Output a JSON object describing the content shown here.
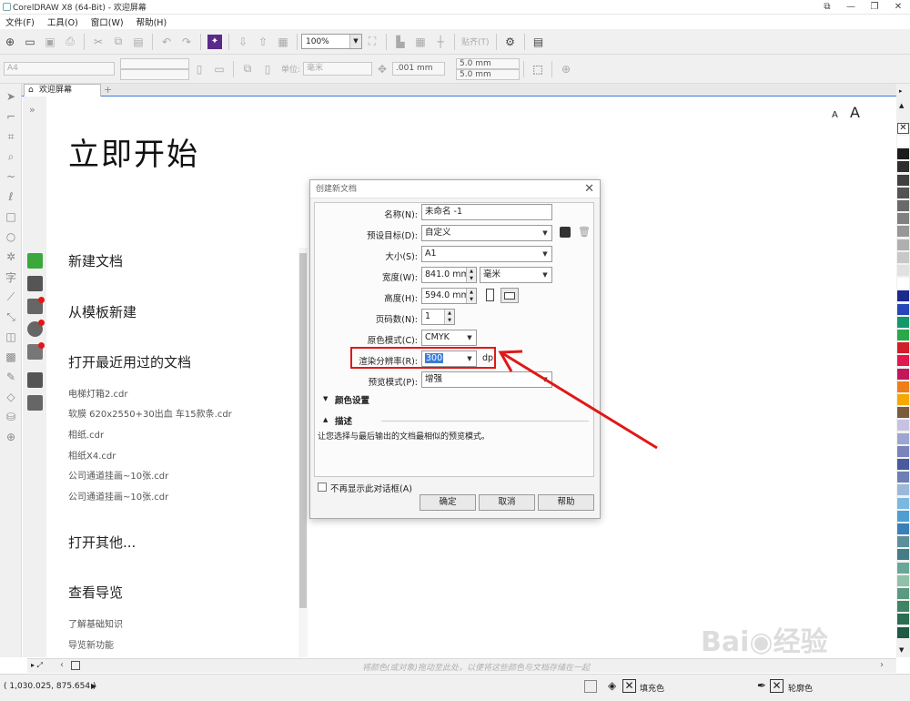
{
  "window": {
    "title": "CorelDRAW X8 (64-Bit) - 欢迎屏幕",
    "controls": [
      "⧉",
      "—",
      "❐",
      "✕"
    ]
  },
  "menu": [
    "文件(F)",
    "工具(O)",
    "窗口(W)",
    "帮助(H)"
  ],
  "toolbar": {
    "zoom": "100%",
    "snap_label": "贴齐(T)"
  },
  "property_bar": {
    "page_size": "A4",
    "units_label": "单位:",
    "units_value": "毫米",
    "nudge": ".001 mm",
    "dup_x": "5.0 mm",
    "dup_y": "5.0 mm"
  },
  "tab": {
    "label": "欢迎屏幕",
    "plus": "+"
  },
  "welcome": {
    "title": "立即开始",
    "new_doc": "新建文档",
    "from_template": "从模板新建",
    "open_recent": "打开最近用过的文档",
    "recent_files": [
      "电梯灯箱2.cdr",
      "软膜 620x2550+30出血 车15款条.cdr",
      "相纸.cdr",
      "相纸X4.cdr",
      "公司通道挂画~10张.cdr",
      "公司通道挂画~10张.cdr"
    ],
    "open_other": "打开其他...",
    "guide": "查看导览",
    "guide_items": [
      "了解基础知识",
      "导览新功能"
    ],
    "font_small": "A",
    "font_large": "A"
  },
  "dialog": {
    "title": "创建新文档",
    "close": "✕",
    "fields": [
      {
        "label": "名称(N):",
        "value": "未命名 -1"
      },
      {
        "label": "预设目标(D):",
        "value": "自定义"
      },
      {
        "label": "大小(S):",
        "value": "A1"
      },
      {
        "label": "宽度(W):",
        "value": "841.0 mm",
        "unit": "毫米"
      },
      {
        "label": "高度(H):",
        "value": "594.0 mm"
      },
      {
        "label": "页码数(N):",
        "value": "1"
      },
      {
        "label": "原色模式(C):",
        "value": "CMYK"
      },
      {
        "label": "渲染分辨率(R):",
        "value": "300",
        "unit": "dpi"
      },
      {
        "label": "预览模式(P):",
        "value": "增强"
      }
    ],
    "color_settings": "颜色设置",
    "description_header": "描述",
    "description": "让您选择与最后输出的文档最相似的预览模式。",
    "dont_show": "不再显示此对话框(A)",
    "ok": "确定",
    "cancel": "取消",
    "help": "帮助"
  },
  "hscroll_hint": "将颜色(或对象)拖动至此处，以便将这些颜色与文档存储在一起",
  "status": {
    "coords": "( 1,030.025, 875.654 )",
    "fill_label": "填充色",
    "outline_label": "轮廓色"
  },
  "annotation_color": "#e01818",
  "palette_colors": [
    "#ffffff",
    "#1c1c1c",
    "#2e2e2e",
    "#404040",
    "#545454",
    "#6a6a6a",
    "#808080",
    "#979797",
    "#afafaf",
    "#c8c8c8",
    "#e1e1e1",
    "#ffffff",
    "#1b2a8c",
    "#2747b8",
    "#11986b",
    "#2aa84a",
    "#d21e2a",
    "#e0184d",
    "#c2185b",
    "#ef7d18",
    "#f6a800",
    "#7a5c3a",
    "#c7c2e0",
    "#9da5d0",
    "#7b83bd",
    "#4a5a9e",
    "#6d7fb4",
    "#9bb8d8",
    "#79b8e0",
    "#4f9ed1",
    "#3a7fb8",
    "#5c8f9c",
    "#457d86",
    "#67a89a",
    "#8fc0a8",
    "#5a9a80",
    "#3e8465",
    "#2b6e52",
    "#1e5a44"
  ]
}
